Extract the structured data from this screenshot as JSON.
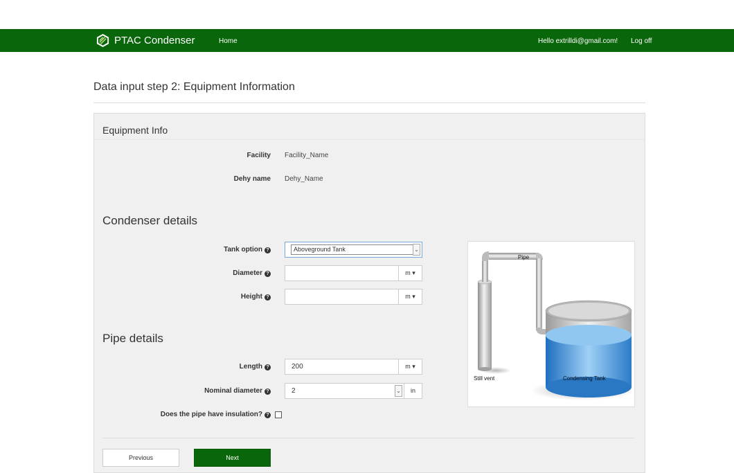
{
  "nav": {
    "brand": "PTAC Condenser",
    "home": "Home",
    "greeting": "Hello extrilldi@gmail.com!",
    "logoff": "Log off"
  },
  "page": {
    "title": "Data input step 2: Equipment Information"
  },
  "equipment_info": {
    "heading": "Equipment Info",
    "facility_label": "Facility",
    "facility_value": "Facility_Name",
    "dehy_label": "Dehy name",
    "dehy_value": "Dehy_Name"
  },
  "condenser": {
    "heading": "Condenser details",
    "tank_option_label": "Tank option",
    "tank_option_value": "Aboveground Tank",
    "diameter_label": "Diameter",
    "diameter_value": "",
    "diameter_unit": "m",
    "height_label": "Height",
    "height_value": "",
    "height_unit": "m"
  },
  "pipe": {
    "heading": "Pipe details",
    "length_label": "Length",
    "length_value": "200",
    "length_unit": "m",
    "nominal_label": "Nominal diameter",
    "nominal_value": "2",
    "nominal_unit": "in",
    "insulation_label": "Does the pipe have insulation?",
    "insulation_checked": false
  },
  "diagram": {
    "pipe_label": "Pipe",
    "vent_label": "Still vent",
    "tank_label": "Condensing Tank"
  },
  "buttons": {
    "previous": "Previous",
    "next": "Next"
  },
  "colors": {
    "brand_green": "#0a660a"
  },
  "icons": {
    "help": "question-circle-icon",
    "caret": "caret-down-icon"
  }
}
